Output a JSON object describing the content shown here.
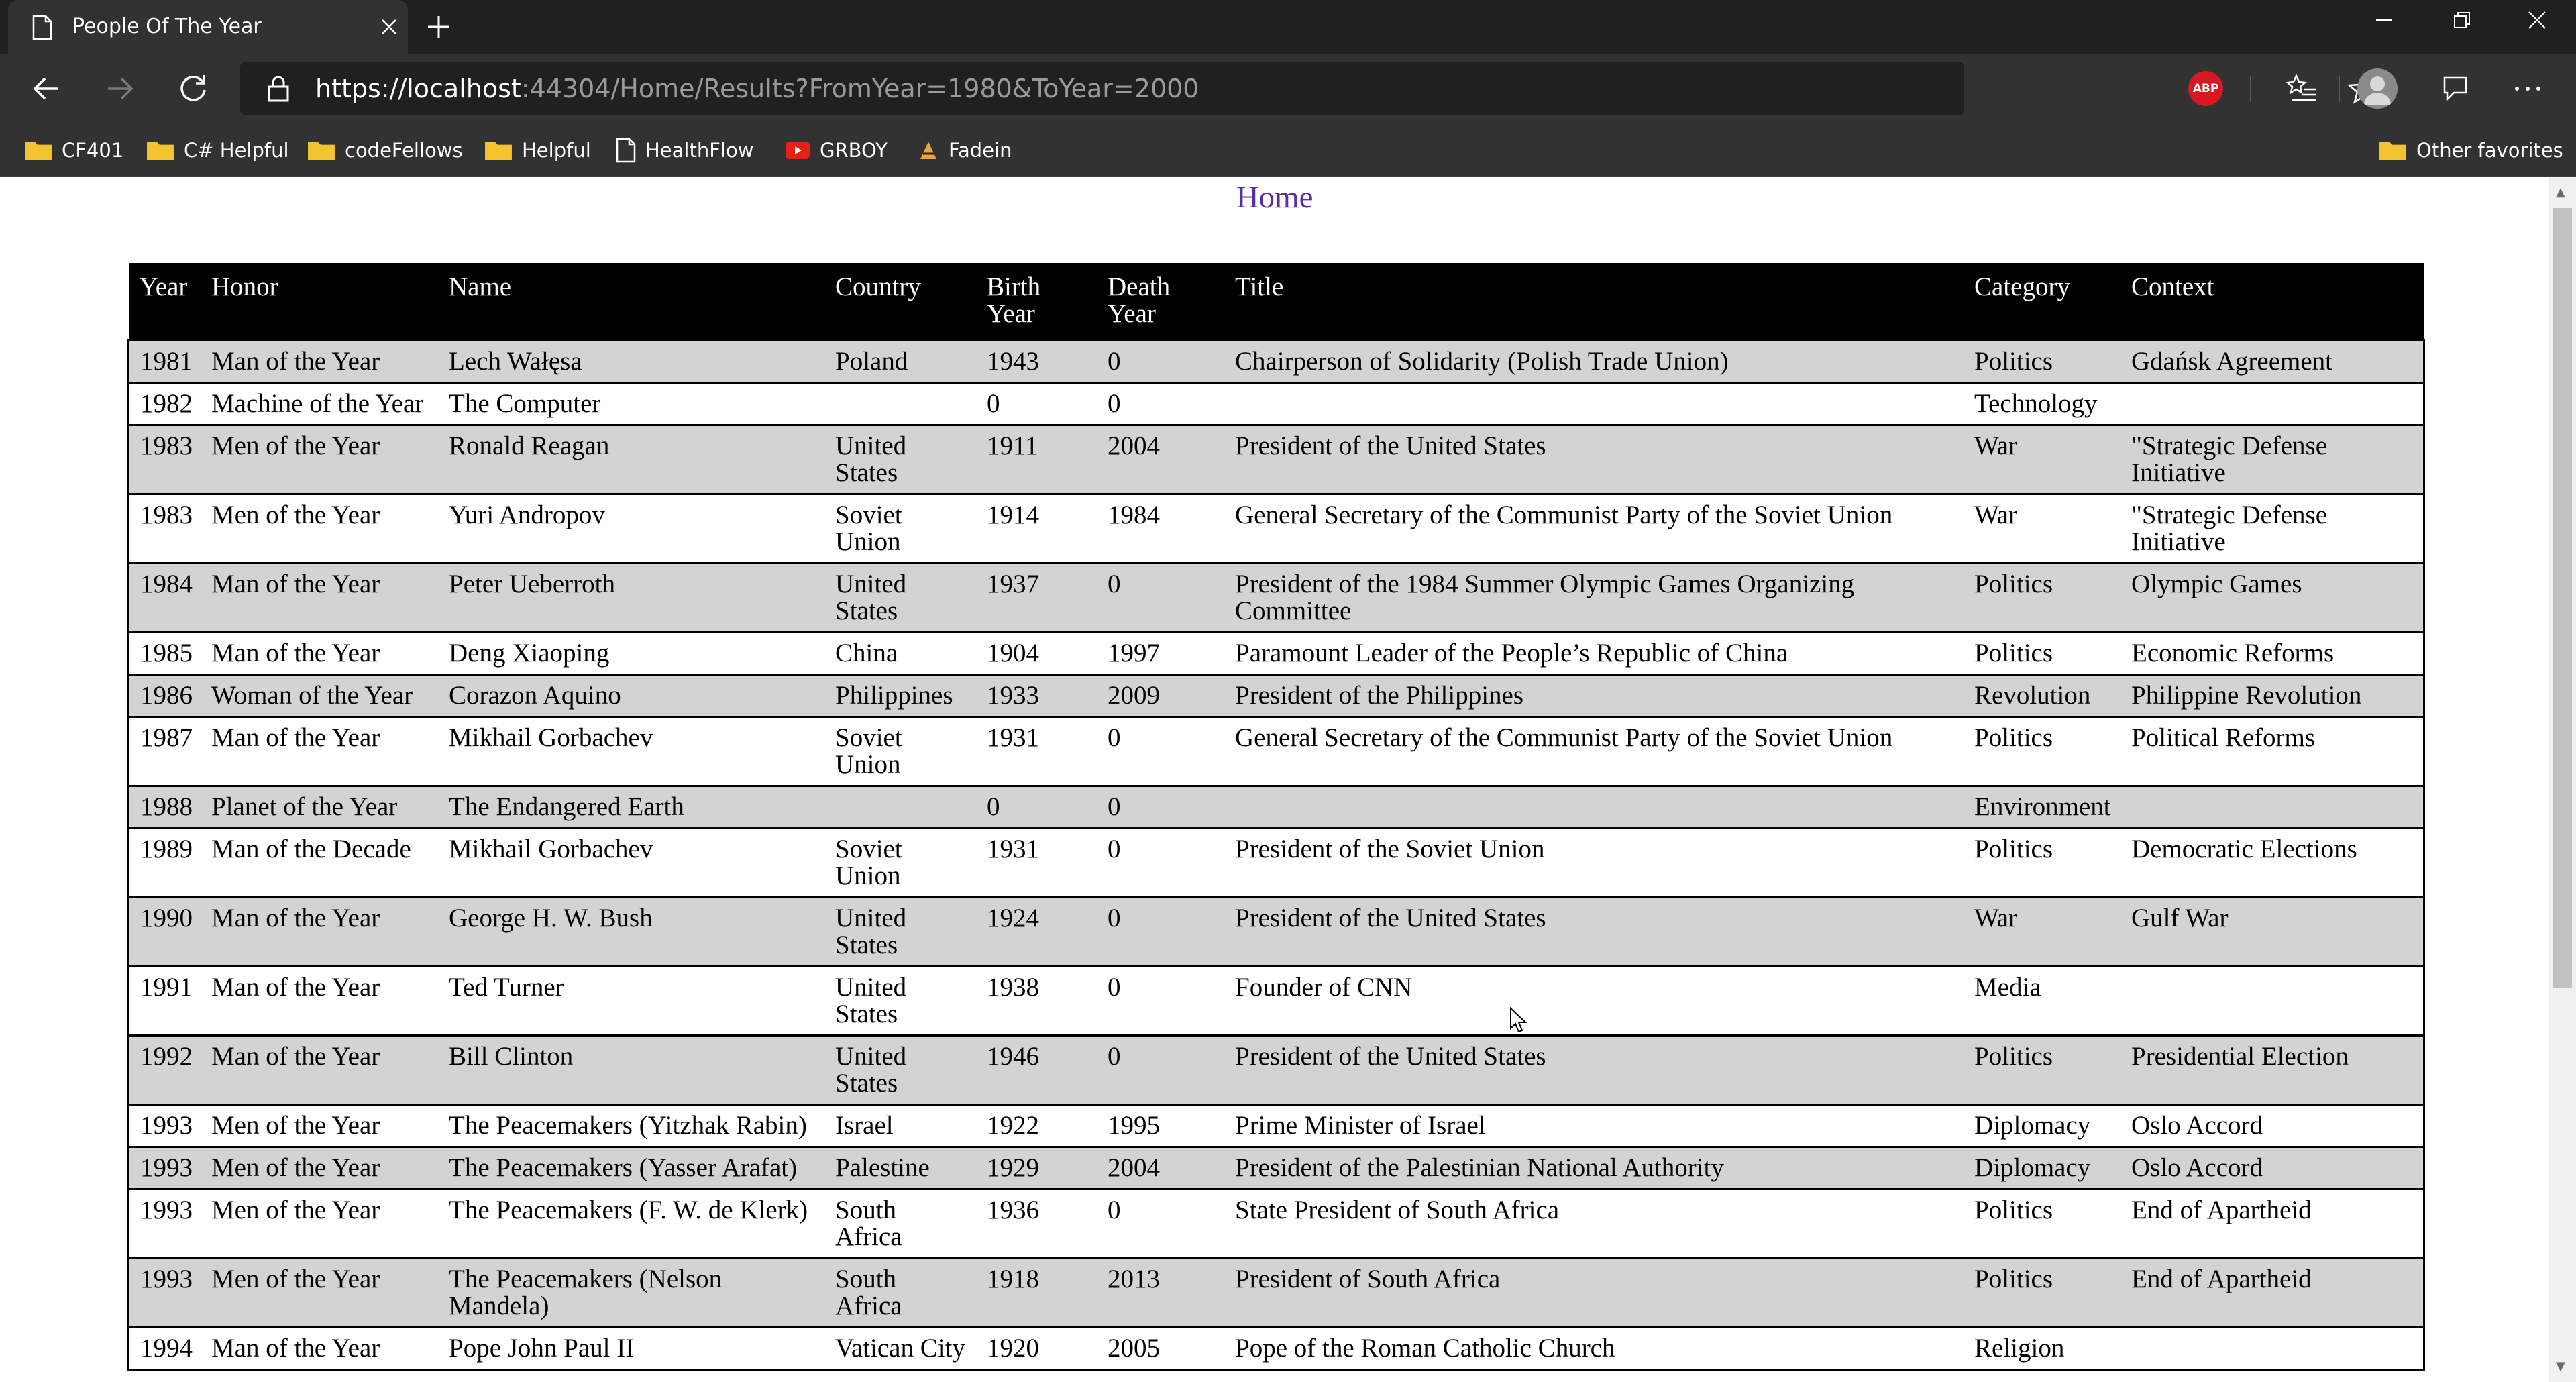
{
  "browser": {
    "tab_title": "People Of The Year",
    "url_host": "https://localhost",
    "url_rest": ":44304/Home/Results?FromYear=1980&ToYear=2000",
    "abp_label": "ABP",
    "bookmarks": [
      {
        "label": "CF401",
        "icon": "folder-icon"
      },
      {
        "label": "C# Helpful",
        "icon": "folder-icon"
      },
      {
        "label": "codeFellows",
        "icon": "folder-icon"
      },
      {
        "label": "Helpful",
        "icon": "folder-icon"
      },
      {
        "label": "HealthFlow",
        "icon": "page-icon"
      },
      {
        "label": "GRBOY",
        "icon": "youtube-icon"
      },
      {
        "label": "Fadein",
        "icon": "fadein-icon"
      }
    ],
    "other_favorites": "Other favorites"
  },
  "page": {
    "home_link": "Home"
  },
  "table": {
    "headers": {
      "year": "Year",
      "honor": "Honor",
      "name": "Name",
      "country": "Country",
      "birth_year": "Birth Year",
      "death_year": "Death Year",
      "title": "Title",
      "category": "Category",
      "context": "Context"
    },
    "rows": [
      {
        "year": "1981",
        "honor": "Man of the Year",
        "name": "Lech Wałęsa",
        "country": "Poland",
        "birth": "1943",
        "death": "0",
        "title": "Chairperson of Solidarity (Polish Trade Union)",
        "category": "Politics",
        "context": "Gdańsk Agreement"
      },
      {
        "year": "1982",
        "honor": "Machine of the Year",
        "name": "The Computer",
        "country": "",
        "birth": "0",
        "death": "0",
        "title": "",
        "category": "Technology",
        "context": ""
      },
      {
        "year": "1983",
        "honor": "Men of the Year",
        "name": "Ronald Reagan",
        "country": "United States",
        "birth": "1911",
        "death": "2004",
        "title": "President of the United States",
        "category": "War",
        "context": "\"Strategic Defense Initiative"
      },
      {
        "year": "1983",
        "honor": "Men of the Year",
        "name": "Yuri Andropov",
        "country": "Soviet Union",
        "birth": "1914",
        "death": "1984",
        "title": "General Secretary of the Communist Party of the Soviet Union",
        "category": "War",
        "context": "\"Strategic Defense Initiative"
      },
      {
        "year": "1984",
        "honor": "Man of the Year",
        "name": "Peter Ueberroth",
        "country": "United States",
        "birth": "1937",
        "death": "0",
        "title": "President of the 1984 Summer Olympic Games Organizing Committee",
        "category": "Politics",
        "context": "Olympic Games"
      },
      {
        "year": "1985",
        "honor": "Man of the Year",
        "name": "Deng Xiaoping",
        "country": "China",
        "birth": "1904",
        "death": "1997",
        "title": "Paramount Leader of the People’s Republic of China",
        "category": "Politics",
        "context": "Economic Reforms"
      },
      {
        "year": "1986",
        "honor": "Woman of the Year",
        "name": "Corazon Aquino",
        "country": "Philippines",
        "birth": "1933",
        "death": "2009",
        "title": "President of the Philippines",
        "category": "Revolution",
        "context": "Philippine Revolution"
      },
      {
        "year": "1987",
        "honor": "Man of the Year",
        "name": "Mikhail Gorbachev",
        "country": "Soviet Union",
        "birth": "1931",
        "death": "0",
        "title": "General Secretary of the Communist Party of the Soviet Union",
        "category": "Politics",
        "context": "Political Reforms"
      },
      {
        "year": "1988",
        "honor": "Planet of the Year",
        "name": "The Endangered Earth",
        "country": "",
        "birth": "0",
        "death": "0",
        "title": "",
        "category": "Environment",
        "context": ""
      },
      {
        "year": "1989",
        "honor": "Man of the Decade",
        "name": "Mikhail Gorbachev",
        "country": "Soviet Union",
        "birth": "1931",
        "death": "0",
        "title": "President of the Soviet Union",
        "category": "Politics",
        "context": "Democratic Elections"
      },
      {
        "year": "1990",
        "honor": "Man of the Year",
        "name": "George H. W. Bush",
        "country": "United States",
        "birth": "1924",
        "death": "0",
        "title": "President of the United States",
        "category": "War",
        "context": "Gulf War"
      },
      {
        "year": "1991",
        "honor": "Man of the Year",
        "name": "Ted Turner",
        "country": "United States",
        "birth": "1938",
        "death": "0",
        "title": "Founder of CNN",
        "category": "Media",
        "context": ""
      },
      {
        "year": "1992",
        "honor": "Man of the Year",
        "name": "Bill Clinton",
        "country": "United States",
        "birth": "1946",
        "death": "0",
        "title": "President of the United States",
        "category": "Politics",
        "context": "Presidential Election"
      },
      {
        "year": "1993",
        "honor": "Men of the Year",
        "name": "The Peacemakers (Yitzhak Rabin)",
        "country": "Israel",
        "birth": "1922",
        "death": "1995",
        "title": "Prime Minister of Israel",
        "category": "Diplomacy",
        "context": "Oslo Accord"
      },
      {
        "year": "1993",
        "honor": "Men of the Year",
        "name": "The Peacemakers (Yasser Arafat)",
        "country": "Palestine",
        "birth": "1929",
        "death": "2004",
        "title": "President of the Palestinian National Authority",
        "category": "Diplomacy",
        "context": "Oslo Accord"
      },
      {
        "year": "1993",
        "honor": "Men of the Year",
        "name": "The Peacemakers (F. W. de Klerk)",
        "country": "South Africa",
        "birth": "1936",
        "death": "0",
        "title": "State President of South Africa",
        "category": "Politics",
        "context": "End of Apartheid"
      },
      {
        "year": "1993",
        "honor": "Men of the Year",
        "name": "The Peacemakers (Nelson Mandela)",
        "country": "South Africa",
        "birth": "1918",
        "death": "2013",
        "title": "President of South Africa",
        "category": "Politics",
        "context": "End of Apartheid"
      },
      {
        "year": "1994",
        "honor": "Man of the Year",
        "name": "Pope John Paul II",
        "country": "Vatican City",
        "birth": "1920",
        "death": "2005",
        "title": "Pope of the Roman Catholic Church",
        "category": "Religion",
        "context": ""
      }
    ]
  }
}
